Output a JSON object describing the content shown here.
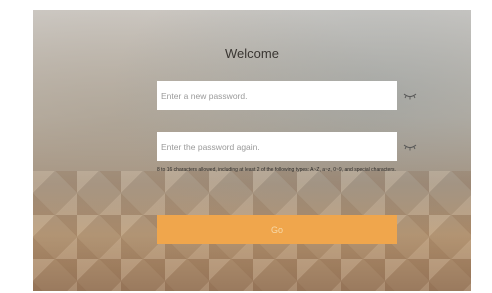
{
  "title": "Welcome",
  "new_password": {
    "placeholder": "Enter a new password.",
    "value": ""
  },
  "confirm_password": {
    "placeholder": "Enter the password again.",
    "value": ""
  },
  "hint": "8 to 16 characters allowed, including at least 2 of the following types: A~Z, a~z, 0~9, and special characters.",
  "go_label": "Go",
  "colors": {
    "button": "#f0a64c",
    "button_text": "#f7d9a8",
    "field_bg": "#ffffff"
  },
  "icons": {
    "toggle_visibility": "eye-closed-icon"
  }
}
